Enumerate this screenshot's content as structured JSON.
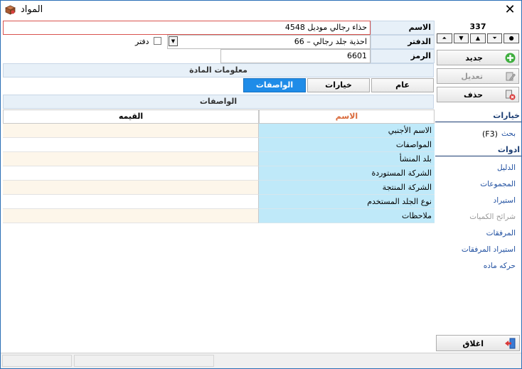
{
  "window": {
    "title": "المواد"
  },
  "form": {
    "name_label": "الاسم",
    "name_value": "حذاء رجالي موديل 4548",
    "book_label": "الدفتر",
    "book_value": "66 – احذية جلد رجالي",
    "book_checkbox_label": "دفتر",
    "code_label": "الرمز",
    "code_value": "6601"
  },
  "material_info_header": "معلومات المادة",
  "tabs": [
    {
      "label": "عام",
      "active": false
    },
    {
      "label": "خيارات",
      "active": false
    },
    {
      "label": "الواصفات",
      "active": true
    }
  ],
  "specs_header": "الواصفات",
  "grid": {
    "col_name": "الاسم",
    "col_value": "القيمه",
    "rows": [
      {
        "name": "الاسم الأجنبي",
        "value": ""
      },
      {
        "name": "المواصفات",
        "value": ""
      },
      {
        "name": "بلد المنشأ",
        "value": ""
      },
      {
        "name": "الشركة المستوردة",
        "value": ""
      },
      {
        "name": "الشركة المنتجة",
        "value": ""
      },
      {
        "name": "نوع الجلد المستخدم",
        "value": ""
      },
      {
        "name": "ملاحظات",
        "value": ""
      }
    ]
  },
  "side": {
    "record_number": "337",
    "nav": [
      "●",
      "▲",
      "▲",
      "▼",
      "▼"
    ],
    "new_label": "جديد",
    "edit_label": "تعديل",
    "delete_label": "حذف",
    "options_header": "خيارات",
    "search_label": "بحث",
    "search_key": "(F3)",
    "tools_header": "ادوات",
    "tools": [
      {
        "label": "الدليل",
        "enabled": true
      },
      {
        "label": "المجموعات",
        "enabled": true
      },
      {
        "label": "استيراد",
        "enabled": true
      },
      {
        "label": "شرائح الكميات",
        "enabled": false
      },
      {
        "label": "المرفقات",
        "enabled": true
      },
      {
        "label": "استيراد المرفقات",
        "enabled": true
      },
      {
        "label": "حركه ماده",
        "enabled": true
      }
    ],
    "close_label": "اغلاق"
  },
  "colors": {
    "accent": "#1f8ce8",
    "name_cell_bg": "#bfe9f9",
    "value_row_alt": "#fdf6ea",
    "link": "#1f4fa0",
    "header_label_bg": "#e7f0f8"
  }
}
